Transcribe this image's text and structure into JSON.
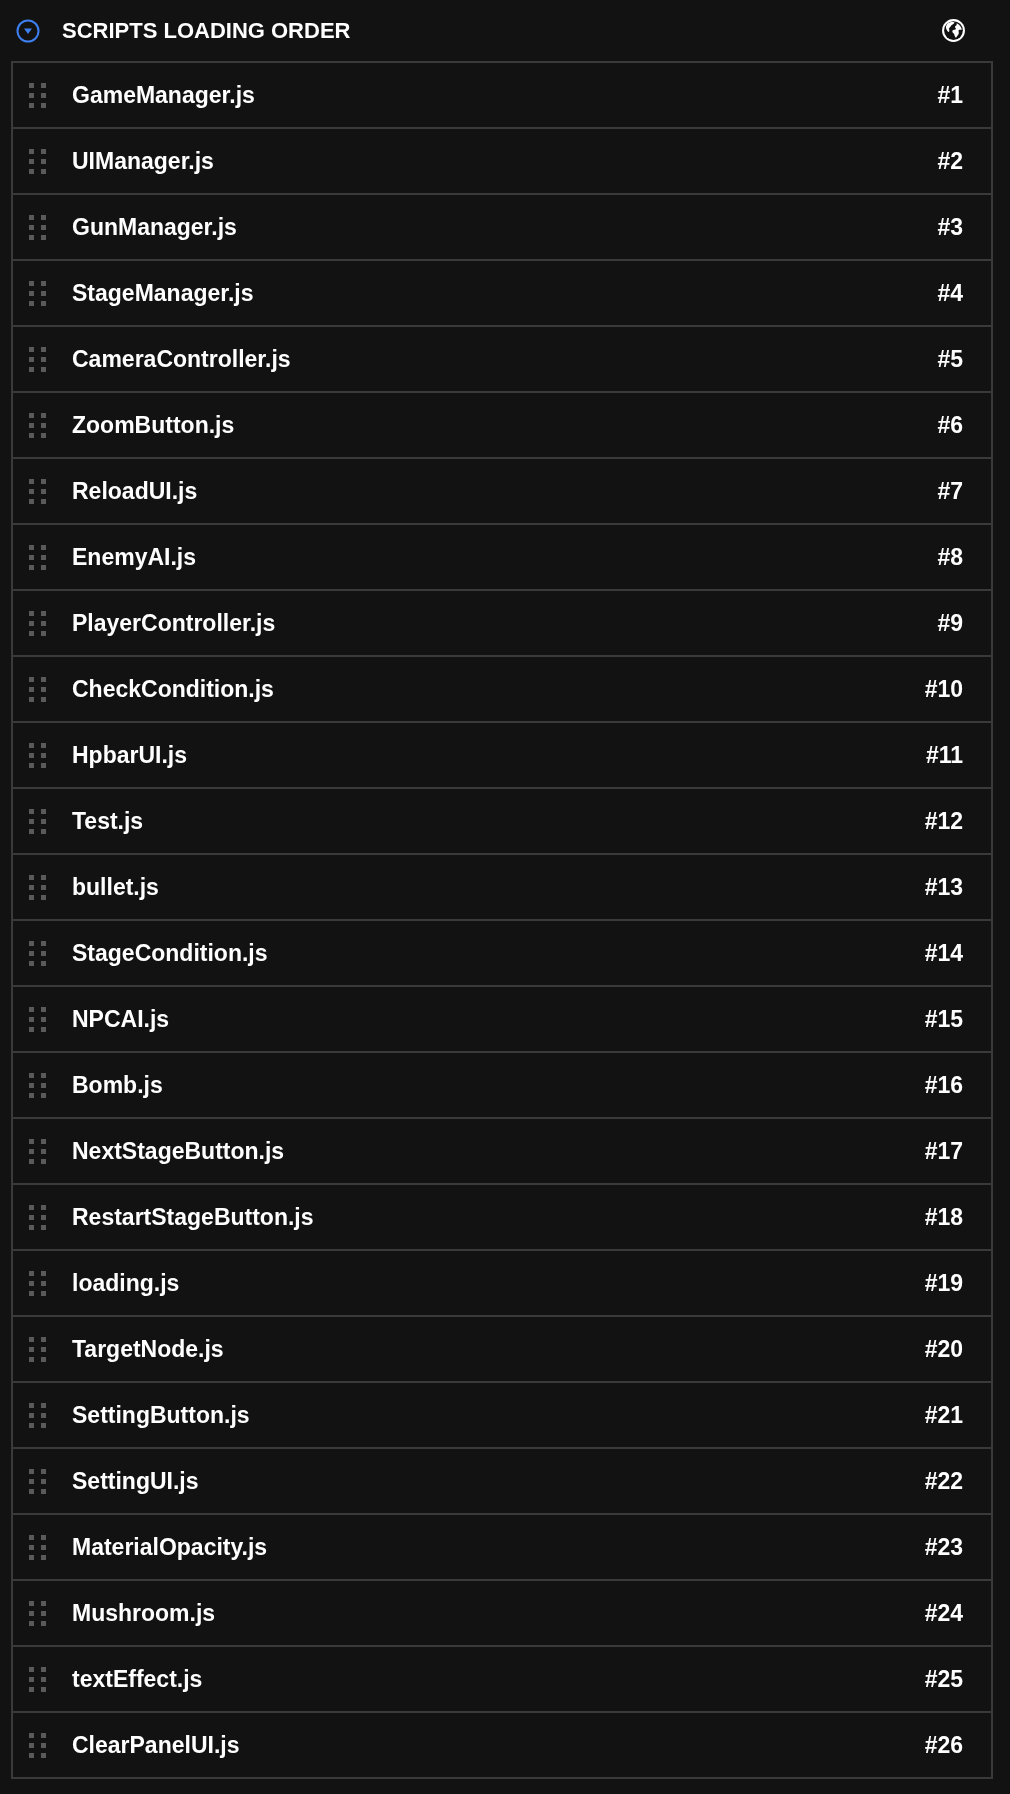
{
  "header": {
    "title": "SCRIPTS LOADING ORDER",
    "expanded": true
  },
  "scripts": [
    {
      "name": "GameManager.js",
      "order": "#1"
    },
    {
      "name": "UIManager.js",
      "order": "#2"
    },
    {
      "name": "GunManager.js",
      "order": "#3"
    },
    {
      "name": "StageManager.js",
      "order": "#4"
    },
    {
      "name": "CameraController.js",
      "order": "#5"
    },
    {
      "name": "ZoomButton.js",
      "order": "#6"
    },
    {
      "name": "ReloadUI.js",
      "order": "#7"
    },
    {
      "name": "EnemyAI.js",
      "order": "#8"
    },
    {
      "name": "PlayerController.js",
      "order": "#9"
    },
    {
      "name": "CheckCondition.js",
      "order": "#10"
    },
    {
      "name": "HpbarUI.js",
      "order": "#11"
    },
    {
      "name": "Test.js",
      "order": "#12"
    },
    {
      "name": "bullet.js",
      "order": "#13"
    },
    {
      "name": "StageCondition.js",
      "order": "#14"
    },
    {
      "name": "NPCAI.js",
      "order": "#15"
    },
    {
      "name": "Bomb.js",
      "order": "#16"
    },
    {
      "name": "NextStageButton.js",
      "order": "#17"
    },
    {
      "name": "RestartStageButton.js",
      "order": "#18"
    },
    {
      "name": "loading.js",
      "order": "#19"
    },
    {
      "name": "TargetNode.js",
      "order": "#20"
    },
    {
      "name": "SettingButton.js",
      "order": "#21"
    },
    {
      "name": "SettingUI.js",
      "order": "#22"
    },
    {
      "name": "MaterialOpacity.js",
      "order": "#23"
    },
    {
      "name": "Mushroom.js",
      "order": "#24"
    },
    {
      "name": "textEffect.js",
      "order": "#25"
    },
    {
      "name": "ClearPanelUI.js",
      "order": "#26"
    }
  ]
}
